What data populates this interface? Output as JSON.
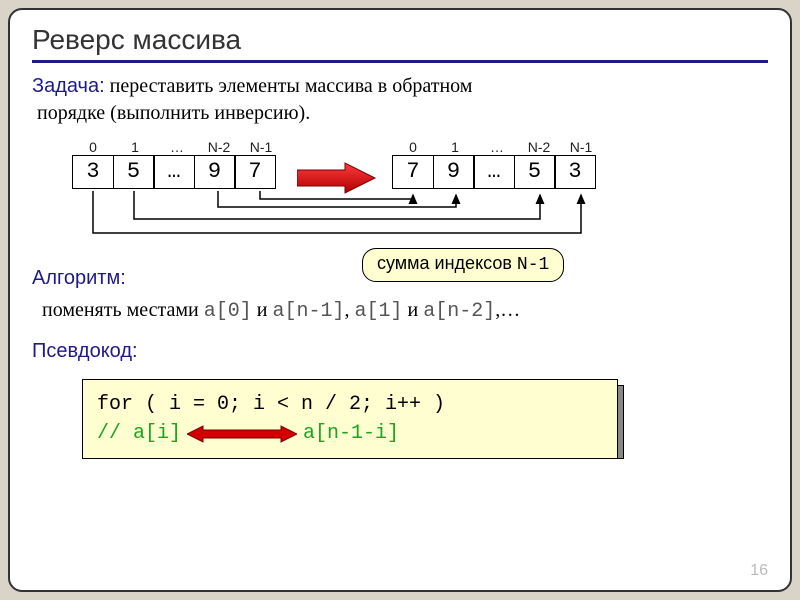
{
  "title": "Реверс массива",
  "task": {
    "label": "Задача:",
    "text1": " переставить элементы массива в обратном",
    "text2": "порядке (выполнить инверсию)."
  },
  "indices": [
    "0",
    "1",
    "…",
    "N-2",
    "N-1"
  ],
  "arrayA": [
    "3",
    "5",
    "…",
    "9",
    "7"
  ],
  "arrayB": [
    "7",
    "9",
    "…",
    "5",
    "3"
  ],
  "algorithm": {
    "label": "Алгоритм:",
    "pre": "поменять местами ",
    "c1": "a[0]",
    "c2": " и ",
    "c3": "a[n-1]",
    "c4": ", ",
    "c5": "a[1]",
    "c6": " и ",
    "c7": "a[n-2]",
    "c8": ",…"
  },
  "callout": {
    "text": "сумма индексов ",
    "code": "N-1"
  },
  "pseudo": {
    "label": "Псевдокод:"
  },
  "code": {
    "line1": "for ( i = 0; i < n / 2; i++ )",
    "comment_pre": " // a[i]",
    "comment_post": "a[n-1-i]"
  },
  "colors": {
    "accent": "#1f1a8a",
    "callout_bg": "#fffed0",
    "arrow_red": "#d20000",
    "comment": "#1aa51f"
  },
  "page": "16"
}
